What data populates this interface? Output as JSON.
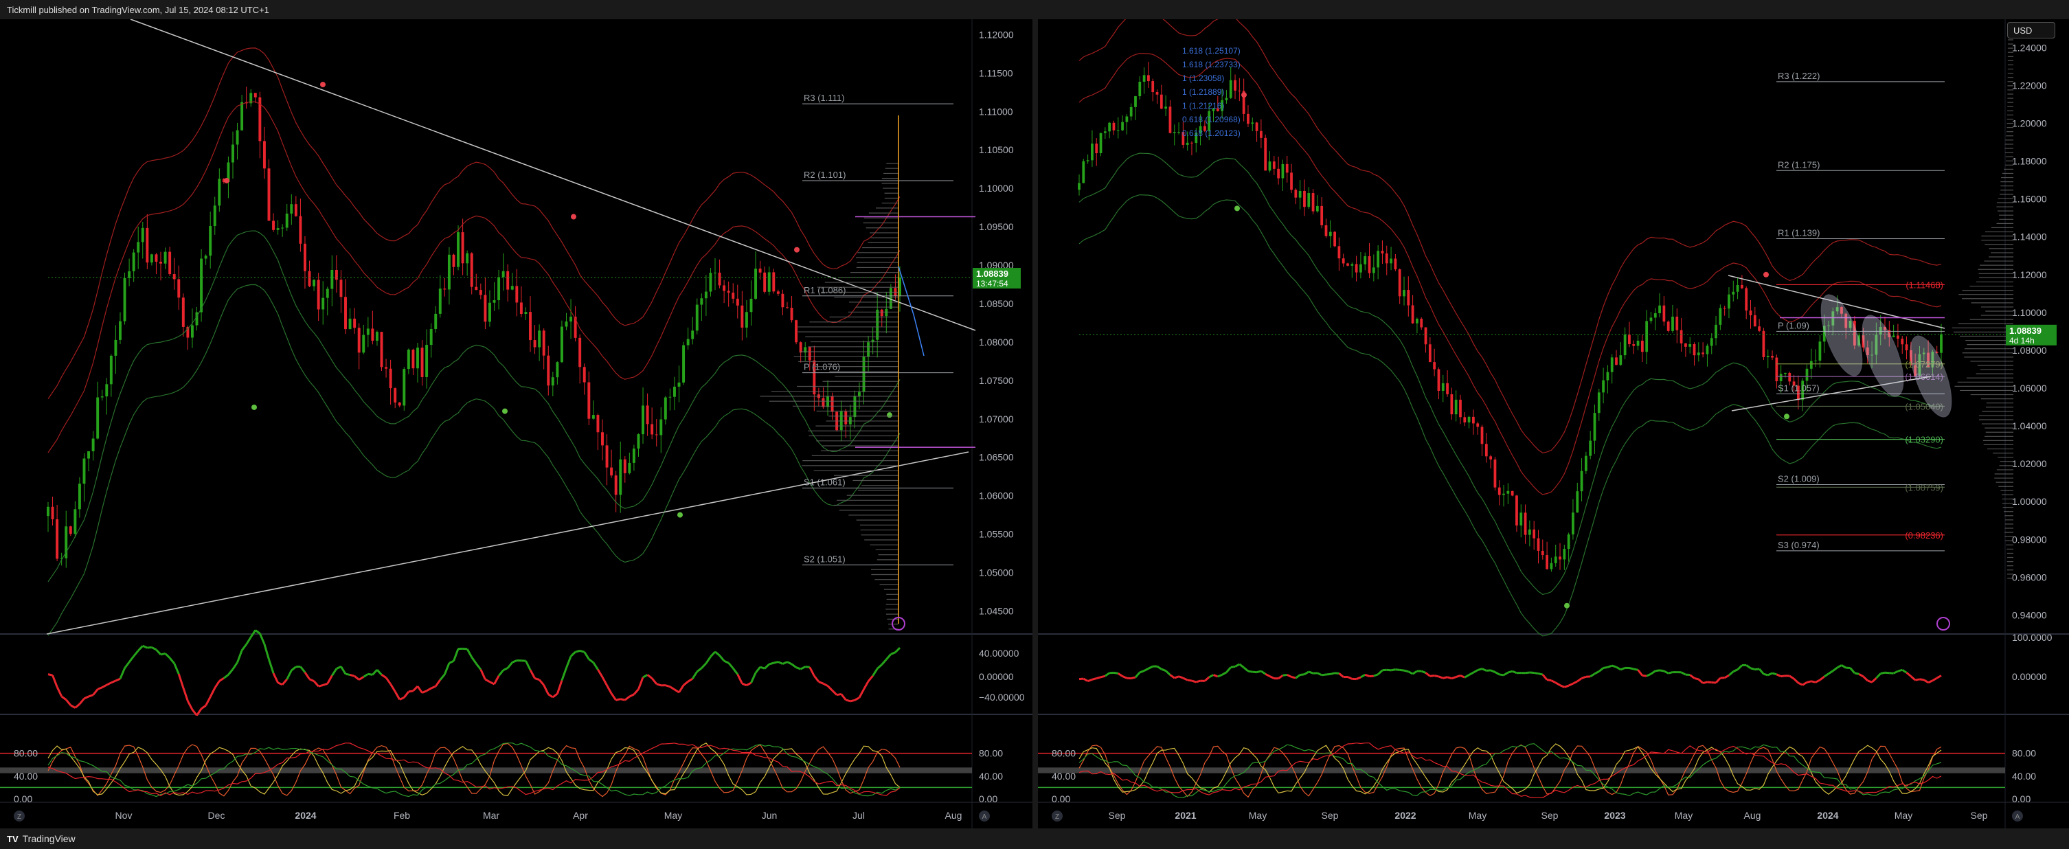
{
  "header": {
    "published": "Tickmill published on TradingView.com, Jul 15, 2024 08:12 UTC+1"
  },
  "footer": {
    "brand": "TradingView",
    "logo": "TV",
    "tz_left": "Z",
    "auto_left": "A",
    "tz_right": "Z",
    "auto_right": "A"
  },
  "currency_select": "USD",
  "colors": {
    "bull": "#26a31a",
    "bear": "#e8252d",
    "band": "#b22222",
    "band_green": "#2e7d32",
    "trend": "#c8c8c8",
    "price_bg": "#1e8e1e",
    "pivot_line": "#9aa0a6",
    "magenta": "#c054d8",
    "orange": "#f5a623"
  },
  "left_chart": {
    "last_price": "1.08839",
    "countdown": "13:47:54",
    "price_axis": [
      "1.12000",
      "1.11500",
      "1.11000",
      "1.10500",
      "1.10000",
      "1.09500",
      "1.09000",
      "1.08500",
      "1.08000",
      "1.07500",
      "1.07000",
      "1.06500",
      "1.06000",
      "1.05500",
      "1.05000",
      "1.04500"
    ],
    "pivots": [
      {
        "label": "R3 (1.111)",
        "value": 1.111
      },
      {
        "label": "R2 (1.101)",
        "value": 1.101
      },
      {
        "label": "R1 (1.086)",
        "value": 1.086
      },
      {
        "label": "P (1.076)",
        "value": 1.076
      },
      {
        "label": "S1 (1.061)",
        "value": 1.061
      },
      {
        "label": "S2 (1.051)",
        "value": 1.051
      }
    ],
    "time_axis": [
      "Nov",
      "Dec",
      "2024",
      "Feb",
      "Mar",
      "Apr",
      "May",
      "Jun",
      "Jul",
      "Aug"
    ],
    "rsi_axis": [
      "40.00000",
      "0.00000",
      "−40.00000"
    ],
    "stoch_axis": [
      "80.00",
      "40.00",
      "0.00"
    ],
    "stoch_axis_right": [
      "80.00",
      "40.00",
      "0.00"
    ]
  },
  "right_chart": {
    "last_price": "1.08839",
    "countdown": "4d 14h",
    "price_axis": [
      "1.24000",
      "1.22000",
      "1.20000",
      "1.18000",
      "1.16000",
      "1.14000",
      "1.12000",
      "1.10000",
      "1.08000",
      "1.06000",
      "1.04000",
      "1.02000",
      "1.00000",
      "0.98000",
      "0.96000",
      "0.94000"
    ],
    "pivots": [
      {
        "label": "R3 (1.222)",
        "value": 1.222
      },
      {
        "label": "R2 (1.175)",
        "value": 1.175
      },
      {
        "label": "R1 (1.139)",
        "value": 1.139
      },
      {
        "label": "P (1.09)",
        "value": 1.09
      },
      {
        "label": "S1 (1.057)",
        "value": 1.057
      },
      {
        "label": "S2 (1.009)",
        "value": 1.009
      },
      {
        "label": "S3 (0.974)",
        "value": 0.974
      }
    ],
    "levels": [
      {
        "label": "(1.11468)",
        "value": 1.11468,
        "color": "#e8252d"
      },
      {
        "label": "(1.07279)",
        "value": 1.07279,
        "color": "#7a8a3a"
      },
      {
        "label": "(1.06614)",
        "value": 1.06614,
        "color": "#8a5a9a"
      },
      {
        "label": "(1.05040)",
        "value": 1.0504,
        "color": "#5a6a4a"
      },
      {
        "label": "(1.03290)",
        "value": 1.0329,
        "color": "#4caf50"
      },
      {
        "label": "(1.00759)",
        "value": 1.00759,
        "color": "#5a6a4a"
      },
      {
        "label": "(0.98236)",
        "value": 0.98236,
        "color": "#e8252d"
      }
    ],
    "fib_labels": [
      "1.618 (1.25107)",
      "1.618 (1.23733)",
      "1 (1.23058)",
      "1 (1.21889)",
      "1 (1.21216)",
      "0.618 (1.20968)",
      "0.618 (1.20123)"
    ],
    "time_axis": [
      "Sep",
      "2021",
      "May",
      "Sep",
      "2022",
      "May",
      "Sep",
      "2023",
      "May",
      "Aug",
      "2024",
      "May",
      "Sep"
    ],
    "rsi_axis": [
      "100.0000",
      "0.00000"
    ],
    "stoch_axis": [
      "80.00",
      "40.00",
      "0.00"
    ],
    "stoch_axis_right": [
      "80.00",
      "40.00",
      "0.00"
    ]
  },
  "chart_data": [
    {
      "type": "candlestick",
      "title": "",
      "xlabel": "",
      "ylabel": "",
      "ylim": [
        1.042,
        1.122
      ],
      "x_ticks": [
        "Nov",
        "Dec",
        "2024",
        "Feb",
        "Mar",
        "Apr",
        "May",
        "Jun",
        "Jul",
        "Aug"
      ],
      "close_path": [
        1.057,
        1.052,
        1.058,
        1.066,
        1.072,
        1.079,
        1.088,
        1.095,
        1.09,
        1.092,
        1.086,
        1.081,
        1.09,
        1.098,
        1.104,
        1.11,
        1.114,
        1.098,
        1.093,
        1.097,
        1.088,
        1.085,
        1.09,
        1.083,
        1.079,
        1.083,
        1.076,
        1.072,
        1.078,
        1.077,
        1.083,
        1.09,
        1.093,
        1.086,
        1.084,
        1.09,
        1.088,
        1.083,
        1.08,
        1.075,
        1.084,
        1.079,
        1.07,
        1.066,
        1.062,
        1.066,
        1.07,
        1.068,
        1.072,
        1.077,
        1.082,
        1.087,
        1.088,
        1.085,
        1.081,
        1.09,
        1.087,
        1.085,
        1.08,
        1.077,
        1.072,
        1.07,
        1.071,
        1.075,
        1.081,
        1.086,
        1.088
      ],
      "last_close": 1.08839
    },
    {
      "type": "candlestick",
      "title": "",
      "xlabel": "",
      "ylabel": "",
      "ylim": [
        0.93,
        1.255
      ],
      "x_ticks": [
        "Sep",
        "2021",
        "May",
        "Sep",
        "2022",
        "May",
        "Sep",
        "2023",
        "May",
        "Aug",
        "2024",
        "May",
        "Sep"
      ],
      "close_path": [
        1.17,
        1.185,
        1.195,
        1.205,
        1.215,
        1.225,
        1.205,
        1.19,
        1.19,
        1.205,
        1.215,
        1.22,
        1.2,
        1.18,
        1.175,
        1.165,
        1.16,
        1.15,
        1.13,
        1.12,
        1.125,
        1.13,
        1.12,
        1.1,
        1.085,
        1.06,
        1.05,
        1.045,
        1.03,
        1.01,
        1.0,
        0.985,
        0.97,
        0.965,
        0.98,
        1.02,
        1.05,
        1.07,
        1.085,
        1.08,
        1.1,
        1.095,
        1.085,
        1.075,
        1.09,
        1.105,
        1.115,
        1.095,
        1.075,
        1.065,
        1.055,
        1.075,
        1.09,
        1.1,
        1.085,
        1.08,
        1.09,
        1.085,
        1.07,
        1.075,
        1.088
      ],
      "last_close": 1.08839
    }
  ]
}
